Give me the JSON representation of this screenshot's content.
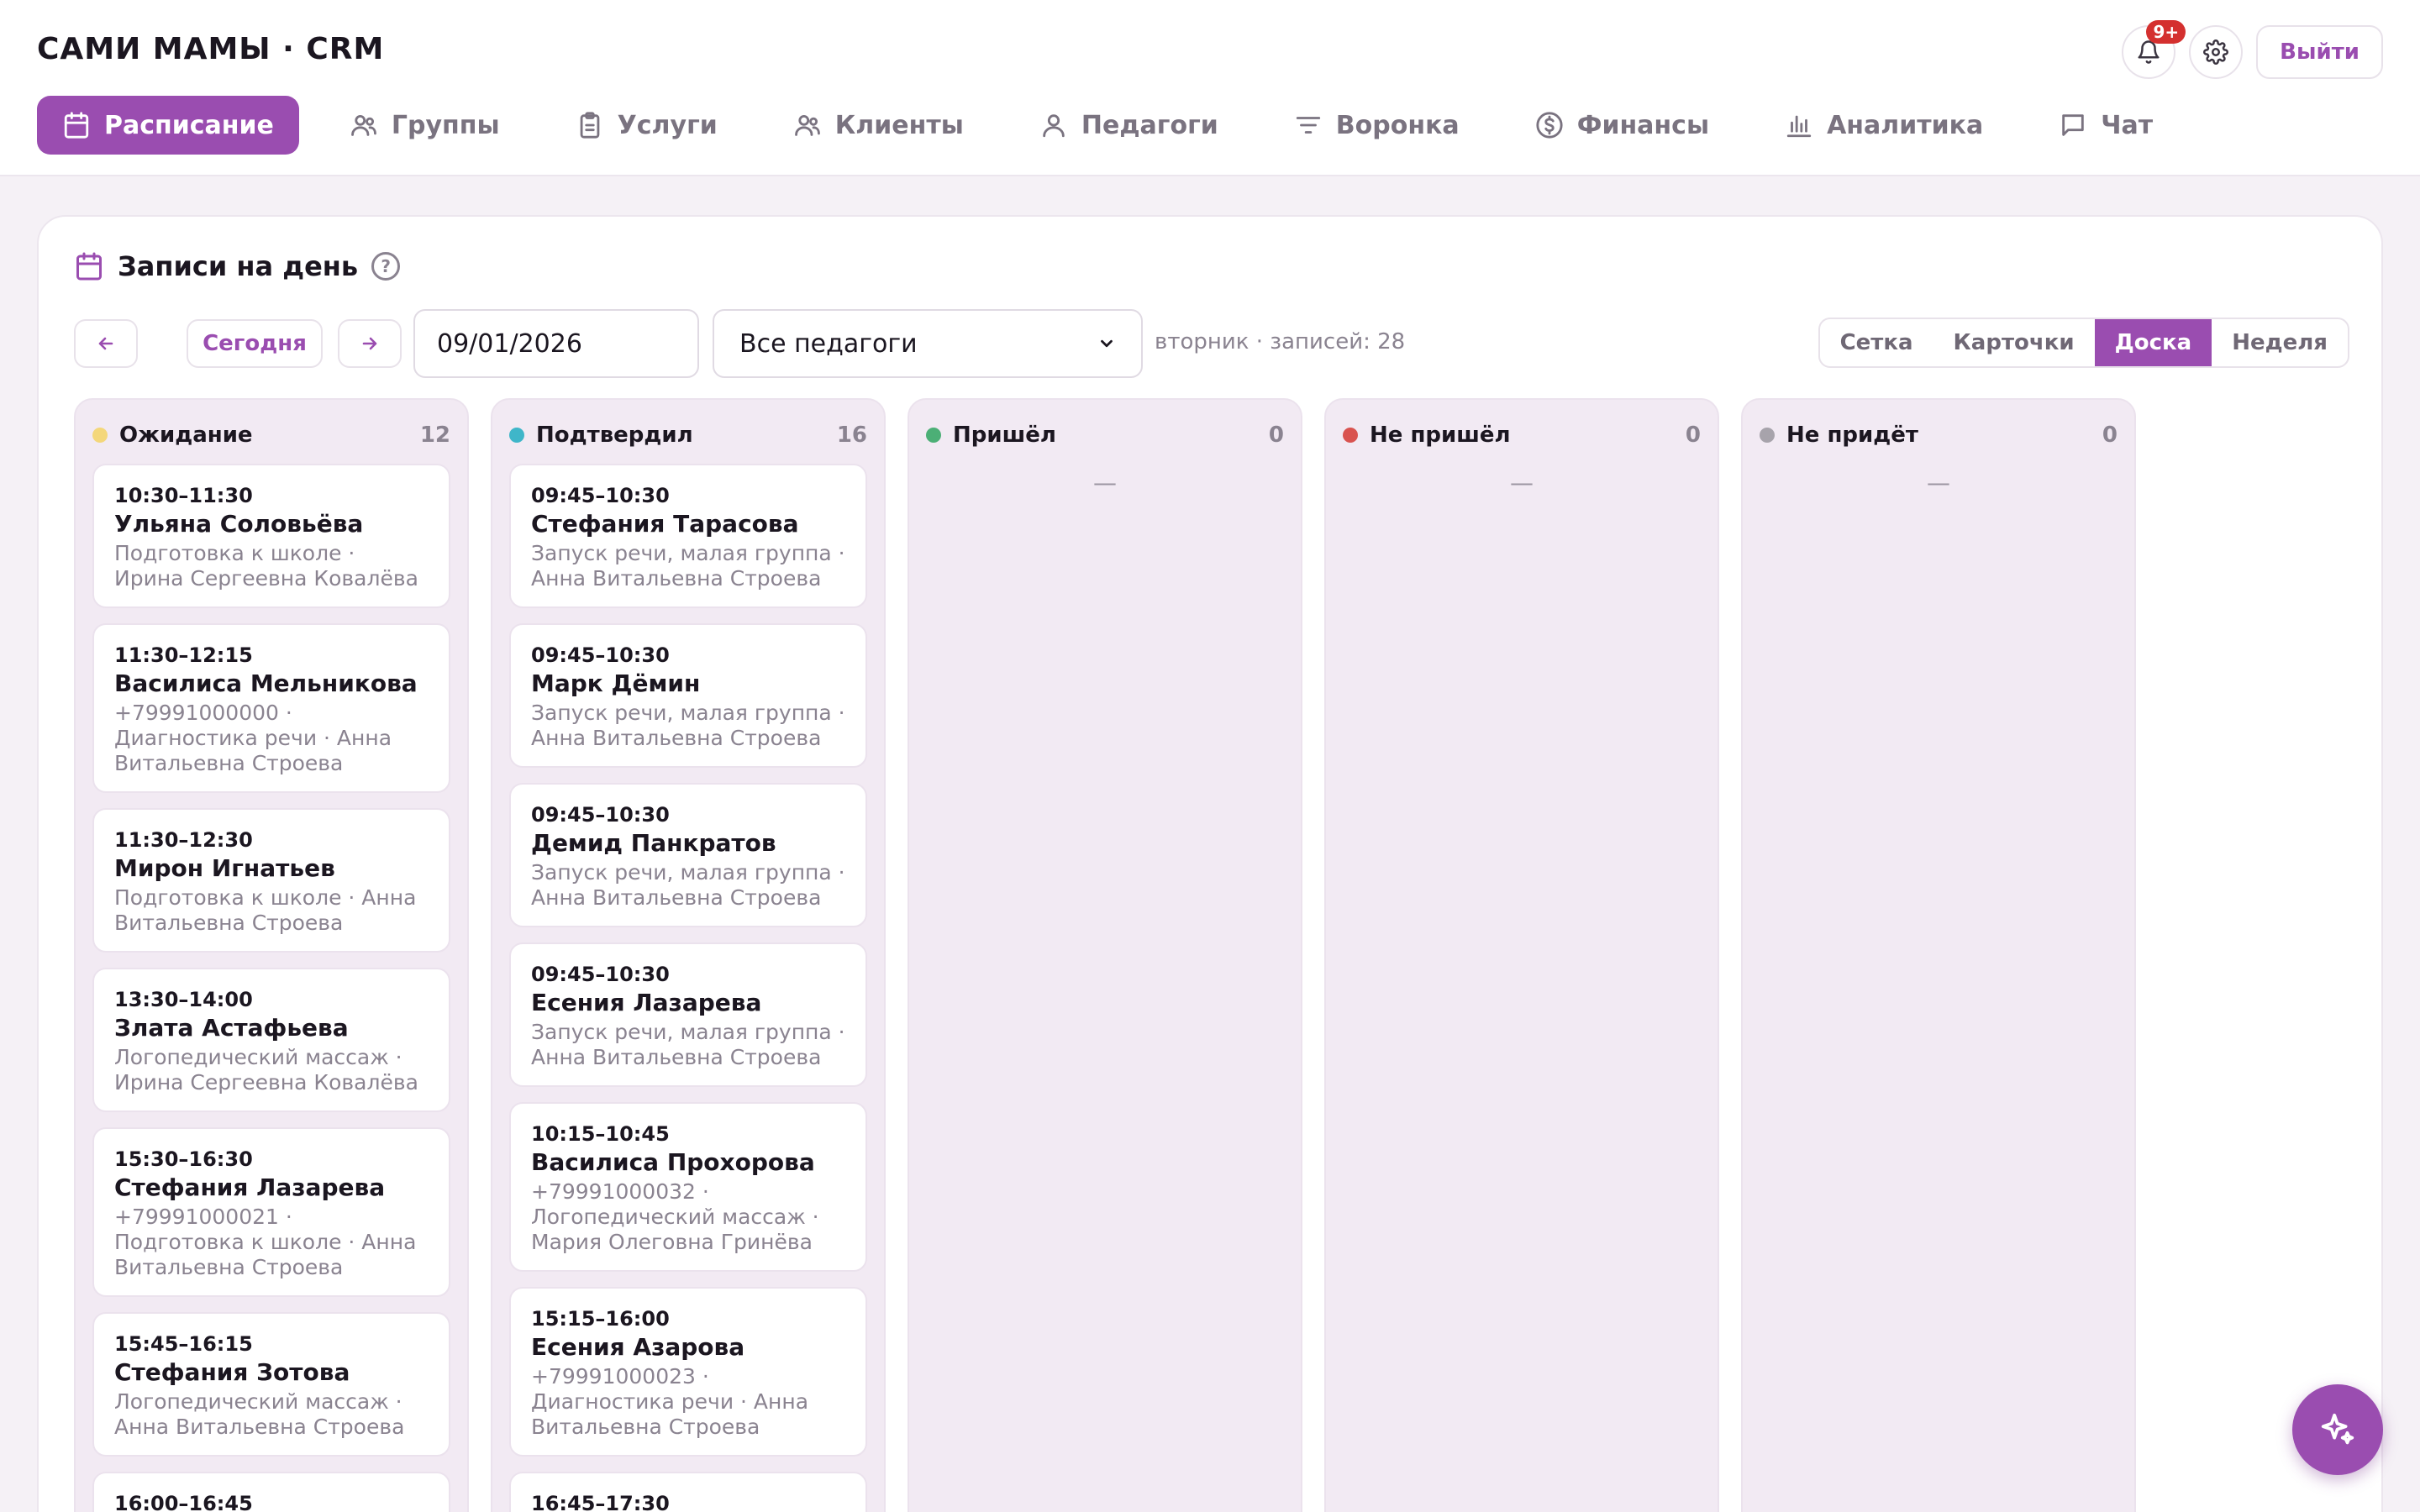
{
  "app": {
    "title": "САМИ МАМЫ · CRM"
  },
  "header": {
    "notifications_badge": "9+",
    "logout_label": "Выйти"
  },
  "nav": [
    {
      "label": "Расписание",
      "icon": "calendar-icon",
      "active": true
    },
    {
      "label": "Группы",
      "icon": "users-icon",
      "active": false
    },
    {
      "label": "Услуги",
      "icon": "clipboard-icon",
      "active": false
    },
    {
      "label": "Клиенты",
      "icon": "users-icon",
      "active": false
    },
    {
      "label": "Педагоги",
      "icon": "user-icon",
      "active": false
    },
    {
      "label": "Воронка",
      "icon": "filter-icon",
      "active": false
    },
    {
      "label": "Финансы",
      "icon": "dollar-icon",
      "active": false
    },
    {
      "label": "Аналитика",
      "icon": "bar-chart-icon",
      "active": false
    },
    {
      "label": "Чат",
      "icon": "chat-icon",
      "active": false
    }
  ],
  "panel": {
    "title": "Записи на день",
    "help": "?",
    "today_label": "Сегодня",
    "date_value": "09/01/2026",
    "teacher_select": "Все педагоги",
    "day_info": "вторник · записей: 28",
    "views": [
      "Сетка",
      "Карточки",
      "Доска",
      "Неделя"
    ],
    "active_view": "Доска"
  },
  "colors": {
    "accent": "#9a4db0",
    "waiting": "#f4d77a",
    "confirmed": "#3fb6c9",
    "came": "#4caf76",
    "no_show": "#d9534f",
    "wont_come": "#a7a3ab"
  },
  "columns": [
    {
      "name": "Ожидание",
      "count": "12",
      "color": "#f4d77a",
      "cards": [
        {
          "time": "10:30–11:30",
          "name": "Ульяна Соловьёва",
          "meta": "Подготовка к школе · Ирина Сергеевна Ковалёва"
        },
        {
          "time": "11:30–12:15",
          "name": "Василиса Мельникова",
          "meta": "+79991000000 · Диагностика речи · Анна Витальевна Строева"
        },
        {
          "time": "11:30–12:30",
          "name": "Мирон Игнатьев",
          "meta": "Подготовка к школе · Анна Витальевна Строева"
        },
        {
          "time": "13:30–14:00",
          "name": "Злата Астафьева",
          "meta": "Логопедический массаж · Ирина Сергеевна Ковалёва"
        },
        {
          "time": "15:30–16:30",
          "name": "Стефания Лазарева",
          "meta": "+79991000021 · Подготовка к школе · Анна Витальевна Строева"
        },
        {
          "time": "15:45–16:15",
          "name": "Стефания Зотова",
          "meta": "Логопедический массаж · Анна Витальевна Строева"
        },
        {
          "time": "16:00–16:45",
          "name": "",
          "meta": ""
        }
      ]
    },
    {
      "name": "Подтвердил",
      "count": "16",
      "color": "#3fb6c9",
      "cards": [
        {
          "time": "09:45–10:30",
          "name": "Стефания Тарасова",
          "meta": "Запуск речи, малая группа · Анна Витальевна Строева"
        },
        {
          "time": "09:45–10:30",
          "name": "Марк Дёмин",
          "meta": "Запуск речи, малая группа · Анна Витальевна Строева"
        },
        {
          "time": "09:45–10:30",
          "name": "Демид Панкратов",
          "meta": "Запуск речи, малая группа · Анна Витальевна Строева"
        },
        {
          "time": "09:45–10:30",
          "name": "Есения Лазарева",
          "meta": "Запуск речи, малая группа · Анна Витальевна Строева"
        },
        {
          "time": "10:15–10:45",
          "name": "Василиса Прохорова",
          "meta": "+79991000032 · Логопедический массаж · Мария Олеговна Гринёва"
        },
        {
          "time": "15:15–16:00",
          "name": "Есения Азарова",
          "meta": "+79991000023 · Диагностика речи · Анна Витальевна Строева"
        },
        {
          "time": "16:45–17:30",
          "name": "",
          "meta": ""
        }
      ]
    },
    {
      "name": "Пришёл",
      "count": "0",
      "color": "#4caf76",
      "empty": "—",
      "cards": []
    },
    {
      "name": "Не пришёл",
      "count": "0",
      "color": "#d9534f",
      "empty": "—",
      "cards": []
    },
    {
      "name": "Не придёт",
      "count": "0",
      "color": "#a7a3ab",
      "empty": "—",
      "cards": []
    }
  ]
}
